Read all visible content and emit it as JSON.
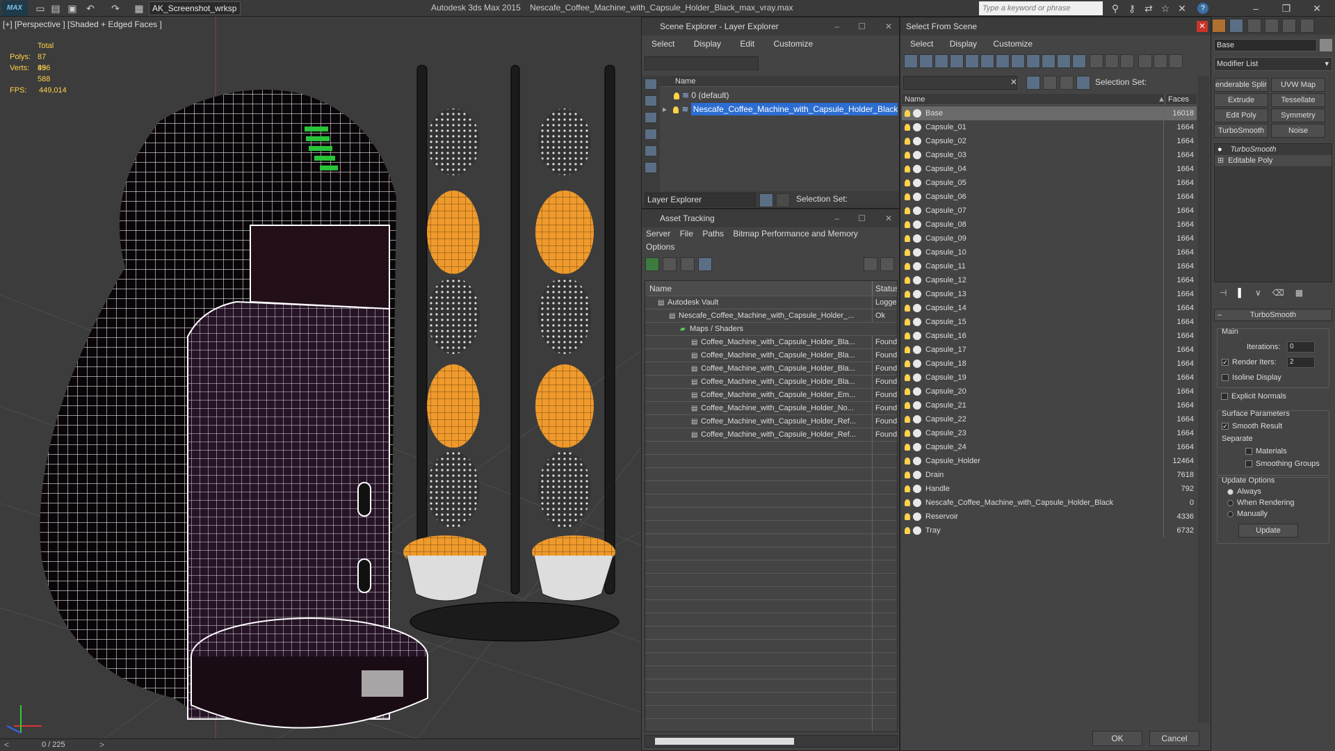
{
  "titlebar": {
    "logo": "MAX",
    "workspace": "AK_Screenshot_wrksp",
    "app_name": "Autodesk 3ds Max  2015",
    "file_name": "Nescafe_Coffee_Machine_with_Capsule_Holder_Black_max_vray.max",
    "search_placeholder": "Type a keyword or phrase"
  },
  "viewport": {
    "label": "[+] [Perspective ] [Shaded + Edged Faces ]",
    "total_label": "Total",
    "polys_label": "Polys:",
    "polys": "87 896",
    "verts_label": "Verts:",
    "verts": "45 588",
    "fps_label": "FPS:",
    "fps": "449,014",
    "frame_counter": "0 / 225"
  },
  "scene_explorer": {
    "title": "Scene Explorer - Layer Explorer",
    "menu": [
      "Select",
      "Display",
      "Edit",
      "Customize"
    ],
    "col_name": "Name",
    "layers": [
      {
        "name": "0 (default)"
      },
      {
        "name": "Nescafe_Coffee_Machine_with_Capsule_Holder_Black"
      }
    ],
    "footer_dropdown": "Layer Explorer",
    "selection_set": "Selection Set:"
  },
  "asset_tracking": {
    "title": "Asset Tracking",
    "menu": [
      "Server",
      "File",
      "Paths",
      "Bitmap Performance and Memory"
    ],
    "menu2": "Options",
    "col_name": "Name",
    "col_status": "Status",
    "rows": [
      {
        "name": "Autodesk Vault",
        "status": "Logge"
      },
      {
        "name": "Nescafe_Coffee_Machine_with_Capsule_Holder_...",
        "status": "Ok"
      },
      {
        "name": "Maps / Shaders",
        "status": ""
      },
      {
        "name": "Coffee_Machine_with_Capsule_Holder_Bla...",
        "status": "Found"
      },
      {
        "name": "Coffee_Machine_with_Capsule_Holder_Bla...",
        "status": "Found"
      },
      {
        "name": "Coffee_Machine_with_Capsule_Holder_Bla...",
        "status": "Found"
      },
      {
        "name": "Coffee_Machine_with_Capsule_Holder_Bla...",
        "status": "Found"
      },
      {
        "name": "Coffee_Machine_with_Capsule_Holder_Em...",
        "status": "Found"
      },
      {
        "name": "Coffee_Machine_with_Capsule_Holder_No...",
        "status": "Found"
      },
      {
        "name": "Coffee_Machine_with_Capsule_Holder_Ref...",
        "status": "Found"
      },
      {
        "name": "Coffee_Machine_with_Capsule_Holder_Ref...",
        "status": "Found"
      }
    ]
  },
  "select_from_scene": {
    "title": "Select From Scene",
    "menu": [
      "Select",
      "Display",
      "Customize"
    ],
    "selection_set": "Selection Set:",
    "col_name": "Name",
    "col_faces": "Faces",
    "ok": "OK",
    "cancel": "Cancel",
    "objects": [
      {
        "name": "Base",
        "faces": "16018"
      },
      {
        "name": "Capsule_01",
        "faces": "1664"
      },
      {
        "name": "Capsule_02",
        "faces": "1664"
      },
      {
        "name": "Capsule_03",
        "faces": "1664"
      },
      {
        "name": "Capsule_04",
        "faces": "1664"
      },
      {
        "name": "Capsule_05",
        "faces": "1664"
      },
      {
        "name": "Capsule_06",
        "faces": "1664"
      },
      {
        "name": "Capsule_07",
        "faces": "1664"
      },
      {
        "name": "Capsule_08",
        "faces": "1664"
      },
      {
        "name": "Capsule_09",
        "faces": "1664"
      },
      {
        "name": "Capsule_10",
        "faces": "1664"
      },
      {
        "name": "Capsule_11",
        "faces": "1664"
      },
      {
        "name": "Capsule_12",
        "faces": "1664"
      },
      {
        "name": "Capsule_13",
        "faces": "1664"
      },
      {
        "name": "Capsule_14",
        "faces": "1664"
      },
      {
        "name": "Capsule_15",
        "faces": "1664"
      },
      {
        "name": "Capsule_16",
        "faces": "1664"
      },
      {
        "name": "Capsule_17",
        "faces": "1664"
      },
      {
        "name": "Capsule_18",
        "faces": "1664"
      },
      {
        "name": "Capsule_19",
        "faces": "1664"
      },
      {
        "name": "Capsule_20",
        "faces": "1664"
      },
      {
        "name": "Capsule_21",
        "faces": "1664"
      },
      {
        "name": "Capsule_22",
        "faces": "1664"
      },
      {
        "name": "Capsule_23",
        "faces": "1664"
      },
      {
        "name": "Capsule_24",
        "faces": "1664"
      },
      {
        "name": "Capsule_Holder",
        "faces": "12464"
      },
      {
        "name": "Drain",
        "faces": "7618"
      },
      {
        "name": "Handle",
        "faces": "792"
      },
      {
        "name": "Nescafe_Coffee_Machine_with_Capsule_Holder_Black",
        "faces": "0"
      },
      {
        "name": "Reservoir",
        "faces": "4336"
      },
      {
        "name": "Tray",
        "faces": "6732"
      }
    ]
  },
  "command_panel": {
    "object_name": "Base",
    "modifier_list": "Modifier List",
    "buttons": [
      "enderable Splir",
      "UVW Map",
      "Extrude",
      "Tessellate",
      "Edit Poly",
      "Symmetry",
      "TurboSmooth",
      "Noise"
    ],
    "stack": [
      "TurboSmooth",
      "Editable Poly"
    ],
    "rollout": "TurboSmooth",
    "main": "Main",
    "iterations_label": "Iterations:",
    "iterations": "0",
    "render_iters_label": "Render Iters:",
    "render_iters": "2",
    "isoline": "Isoline Display",
    "explicit": "Explicit Normals",
    "surface": "Surface Parameters",
    "smooth_result": "Smooth Result",
    "separate": "Separate",
    "materials": "Materials",
    "smoothing_groups": "Smoothing Groups",
    "update_options": "Update Options",
    "always": "Always",
    "when_rendering": "When Rendering",
    "manually": "Manually",
    "update": "Update"
  }
}
